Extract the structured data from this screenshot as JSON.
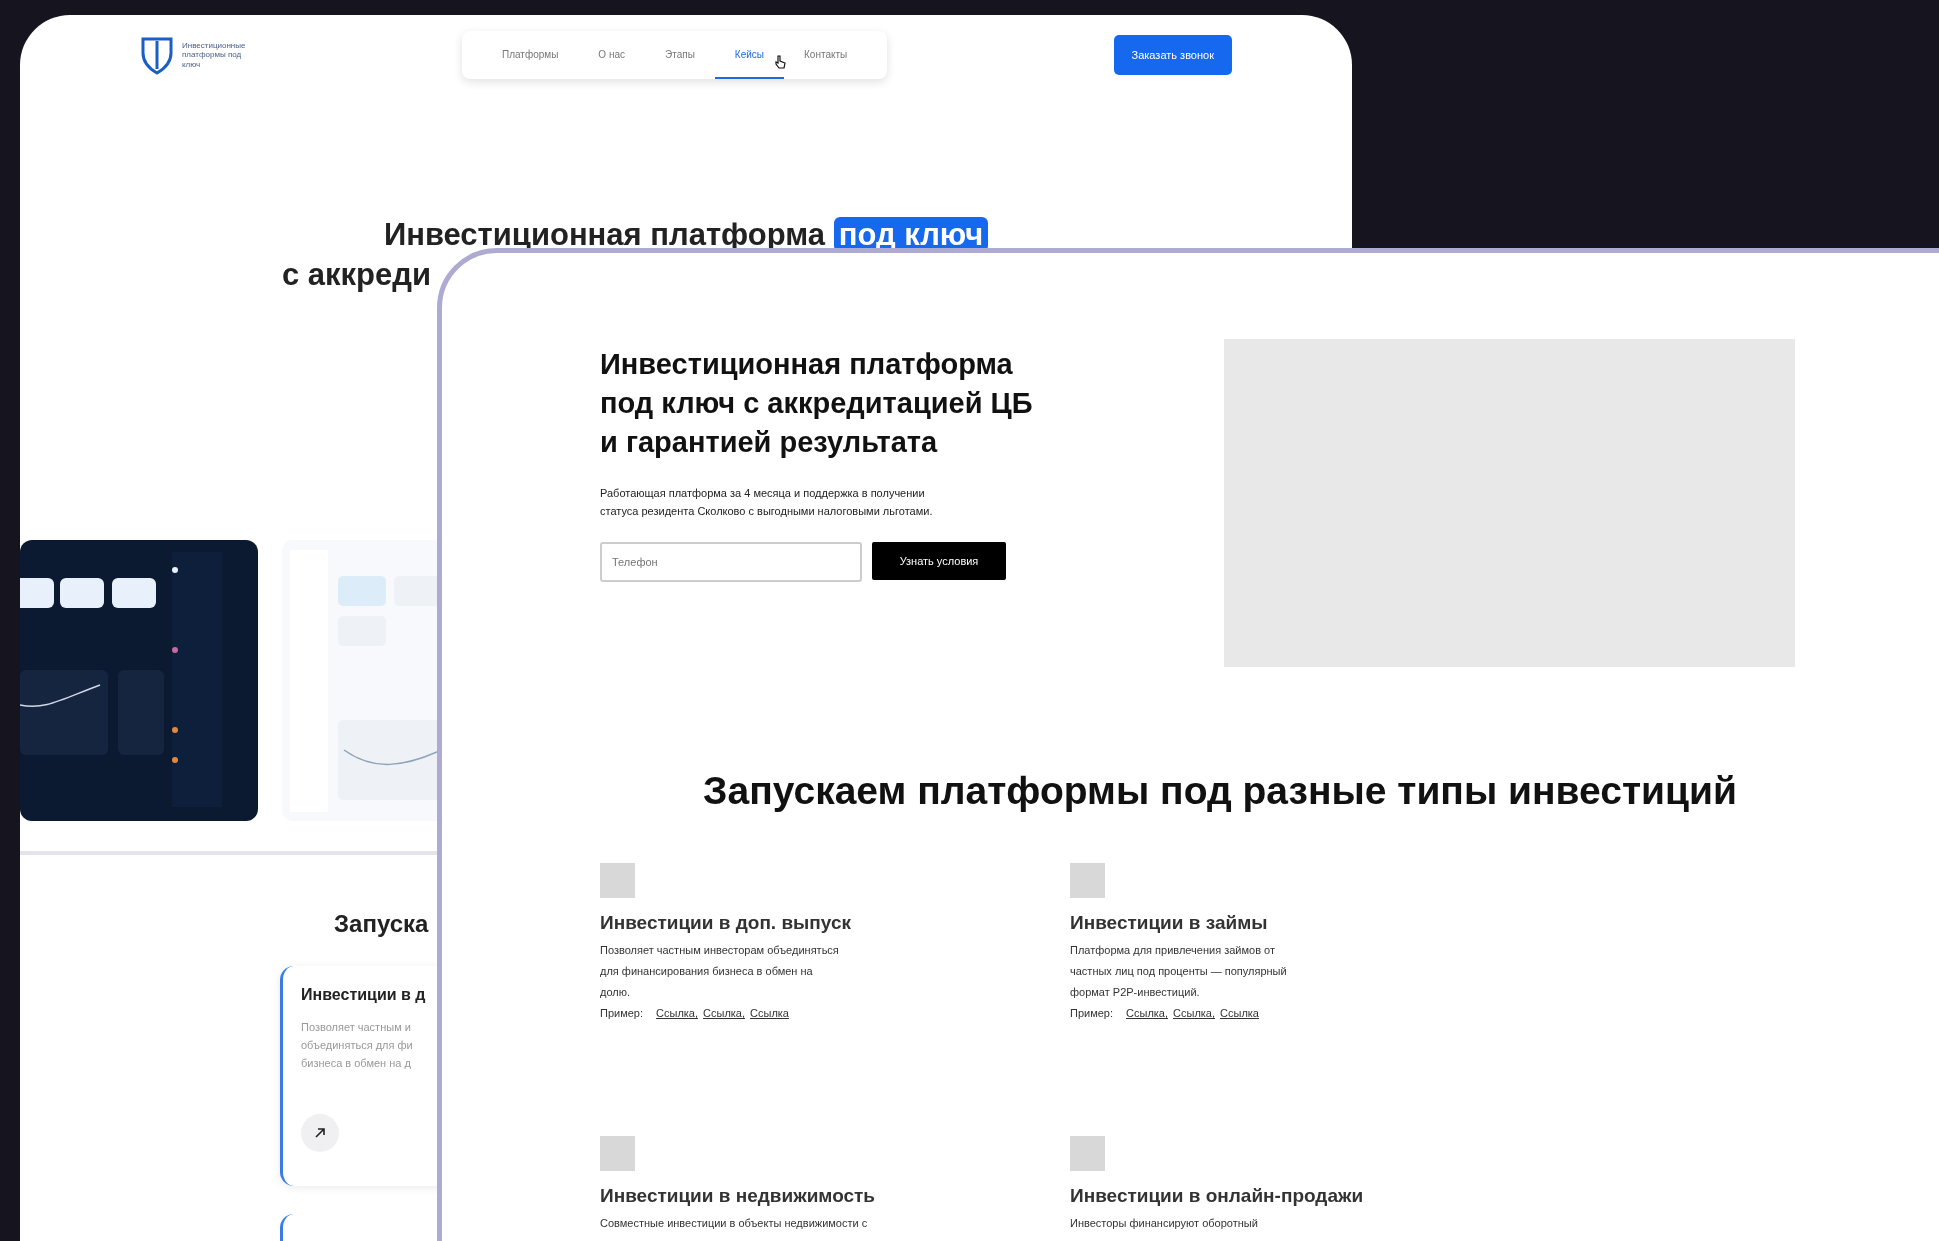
{
  "back_page": {
    "logo_text": "Инвестиционные платформы под ключ",
    "nav": [
      {
        "label": "Платформы",
        "selected": false
      },
      {
        "label": "О нас",
        "selected": false
      },
      {
        "label": "Этапы",
        "selected": false
      },
      {
        "label": "Кейсы",
        "selected": true
      },
      {
        "label": "Контакты",
        "selected": false
      }
    ],
    "cta": "Заказать звонок",
    "hero_parts": [
      {
        "text": "Инвестиционная платформа",
        "highlight": false
      },
      {
        "text": "под ключ",
        "highlight": true
      }
    ],
    "hero_line2": "с аккреди",
    "section_title": "Запуска",
    "card": {
      "title": "Инвестиции в д",
      "lines": [
        "Позволяет частным и",
        "объединяться для фи",
        "бизнеса в обмен на д"
      ]
    }
  },
  "front_page": {
    "title_lines": [
      "Инвестиционная платформа",
      "под ключ с аккредитацией ЦБ",
      "и гарантией результата"
    ],
    "lead": "Работающая платформа за 4 месяца и поддержка в получении статуса резидента Сколково с выгодными налоговыми льготами.",
    "phone": {
      "placeholder": "Телефон"
    },
    "submit": "Узнать условия",
    "section_title": "Запускаем платформы под разные типы инвестиций",
    "cards": [
      {
        "title": "Инвестиции в доп. выпуск",
        "text": "Позволяет частным инвесторам объединяться для финансирования бизнеса в обмен на долю.",
        "example_label": "Пример:",
        "links": [
          "Ссылка,",
          "Ссылка,",
          "Ссылка"
        ]
      },
      {
        "title": "Инвестиции в займы",
        "text": "Платформа для привлечения займов от частных лиц под проценты — популярный формат P2P-инвестиций.",
        "example_label": "Пример:",
        "links": [
          "Ссылка,",
          "Ссылка,",
          "Ссылка"
        ]
      },
      {
        "title": "Инвестиции в недвижимость",
        "text": "Совместные инвестиции в объекты недвижимости с"
      },
      {
        "title": "Инвестиции в онлайн-продажи",
        "text": "Инвесторы финансируют оборотный"
      }
    ]
  }
}
